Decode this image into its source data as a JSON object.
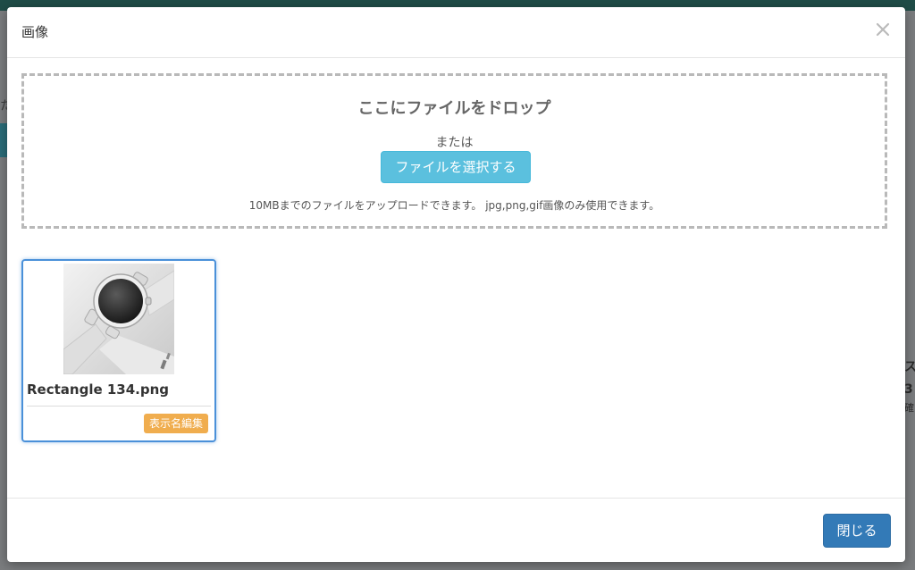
{
  "modal": {
    "title": "画像",
    "dropzone": {
      "title": "ここにファイルをドロップ",
      "or_text": "または",
      "select_button": "ファイルを選択する",
      "note": "10MBまでのファイルをアップロードできます。 jpg,png,gif画像のみ使用できます。"
    },
    "files": [
      {
        "name": "Rectangle 134.png",
        "edit_button": "表示名編集",
        "thumbnail": "watch-thumbnail"
      }
    ],
    "footer": {
      "close_button": "閉じる"
    }
  },
  "background": {
    "left_char": "た",
    "right_chars": [
      "ス",
      "3",
      "確"
    ]
  },
  "colors": {
    "accent_info": "#5bc0de",
    "accent_primary": "#337ab7",
    "accent_warning": "#f0ad4e",
    "selected_border": "#4a90d9"
  }
}
